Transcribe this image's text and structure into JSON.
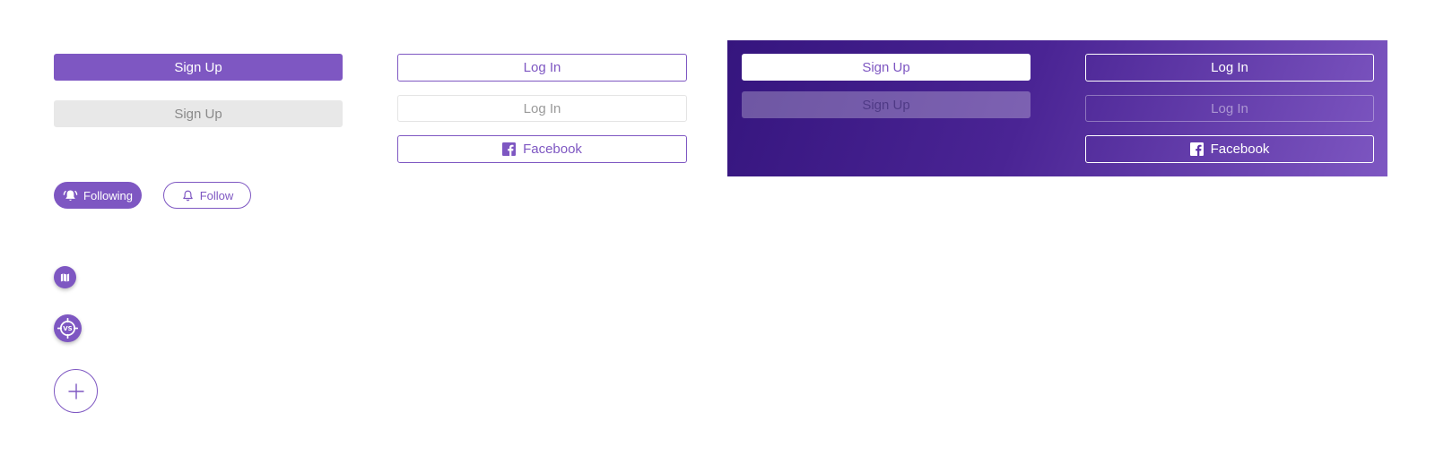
{
  "colors": {
    "accent": "#7e57c2",
    "disabled_bg": "#e8e8e8",
    "panel_gradient_start": "#35157e",
    "panel_gradient_end": "#7e57c2",
    "white": "#ffffff"
  },
  "light": {
    "signup_primary": "Sign Up",
    "signup_disabled": "Sign Up",
    "login_outline": "Log In",
    "login_outline_disabled": "Log In",
    "facebook_outline": "Facebook"
  },
  "dark": {
    "signup_white": "Sign Up",
    "signup_white_disabled": "Sign Up",
    "login_ghost": "Log In",
    "login_ghost_disabled": "Log In",
    "facebook_ghost": "Facebook"
  },
  "follow": {
    "following_label": "Following",
    "follow_label": "Follow"
  },
  "icons": {
    "facebook": "facebook-icon",
    "bell_ringing": "bell-ringing-icon",
    "bell": "bell-icon",
    "map": "map-icon",
    "versus_target": "versus-target-icon",
    "plus": "plus-icon"
  },
  "fab": {
    "versus_text": "VS"
  }
}
